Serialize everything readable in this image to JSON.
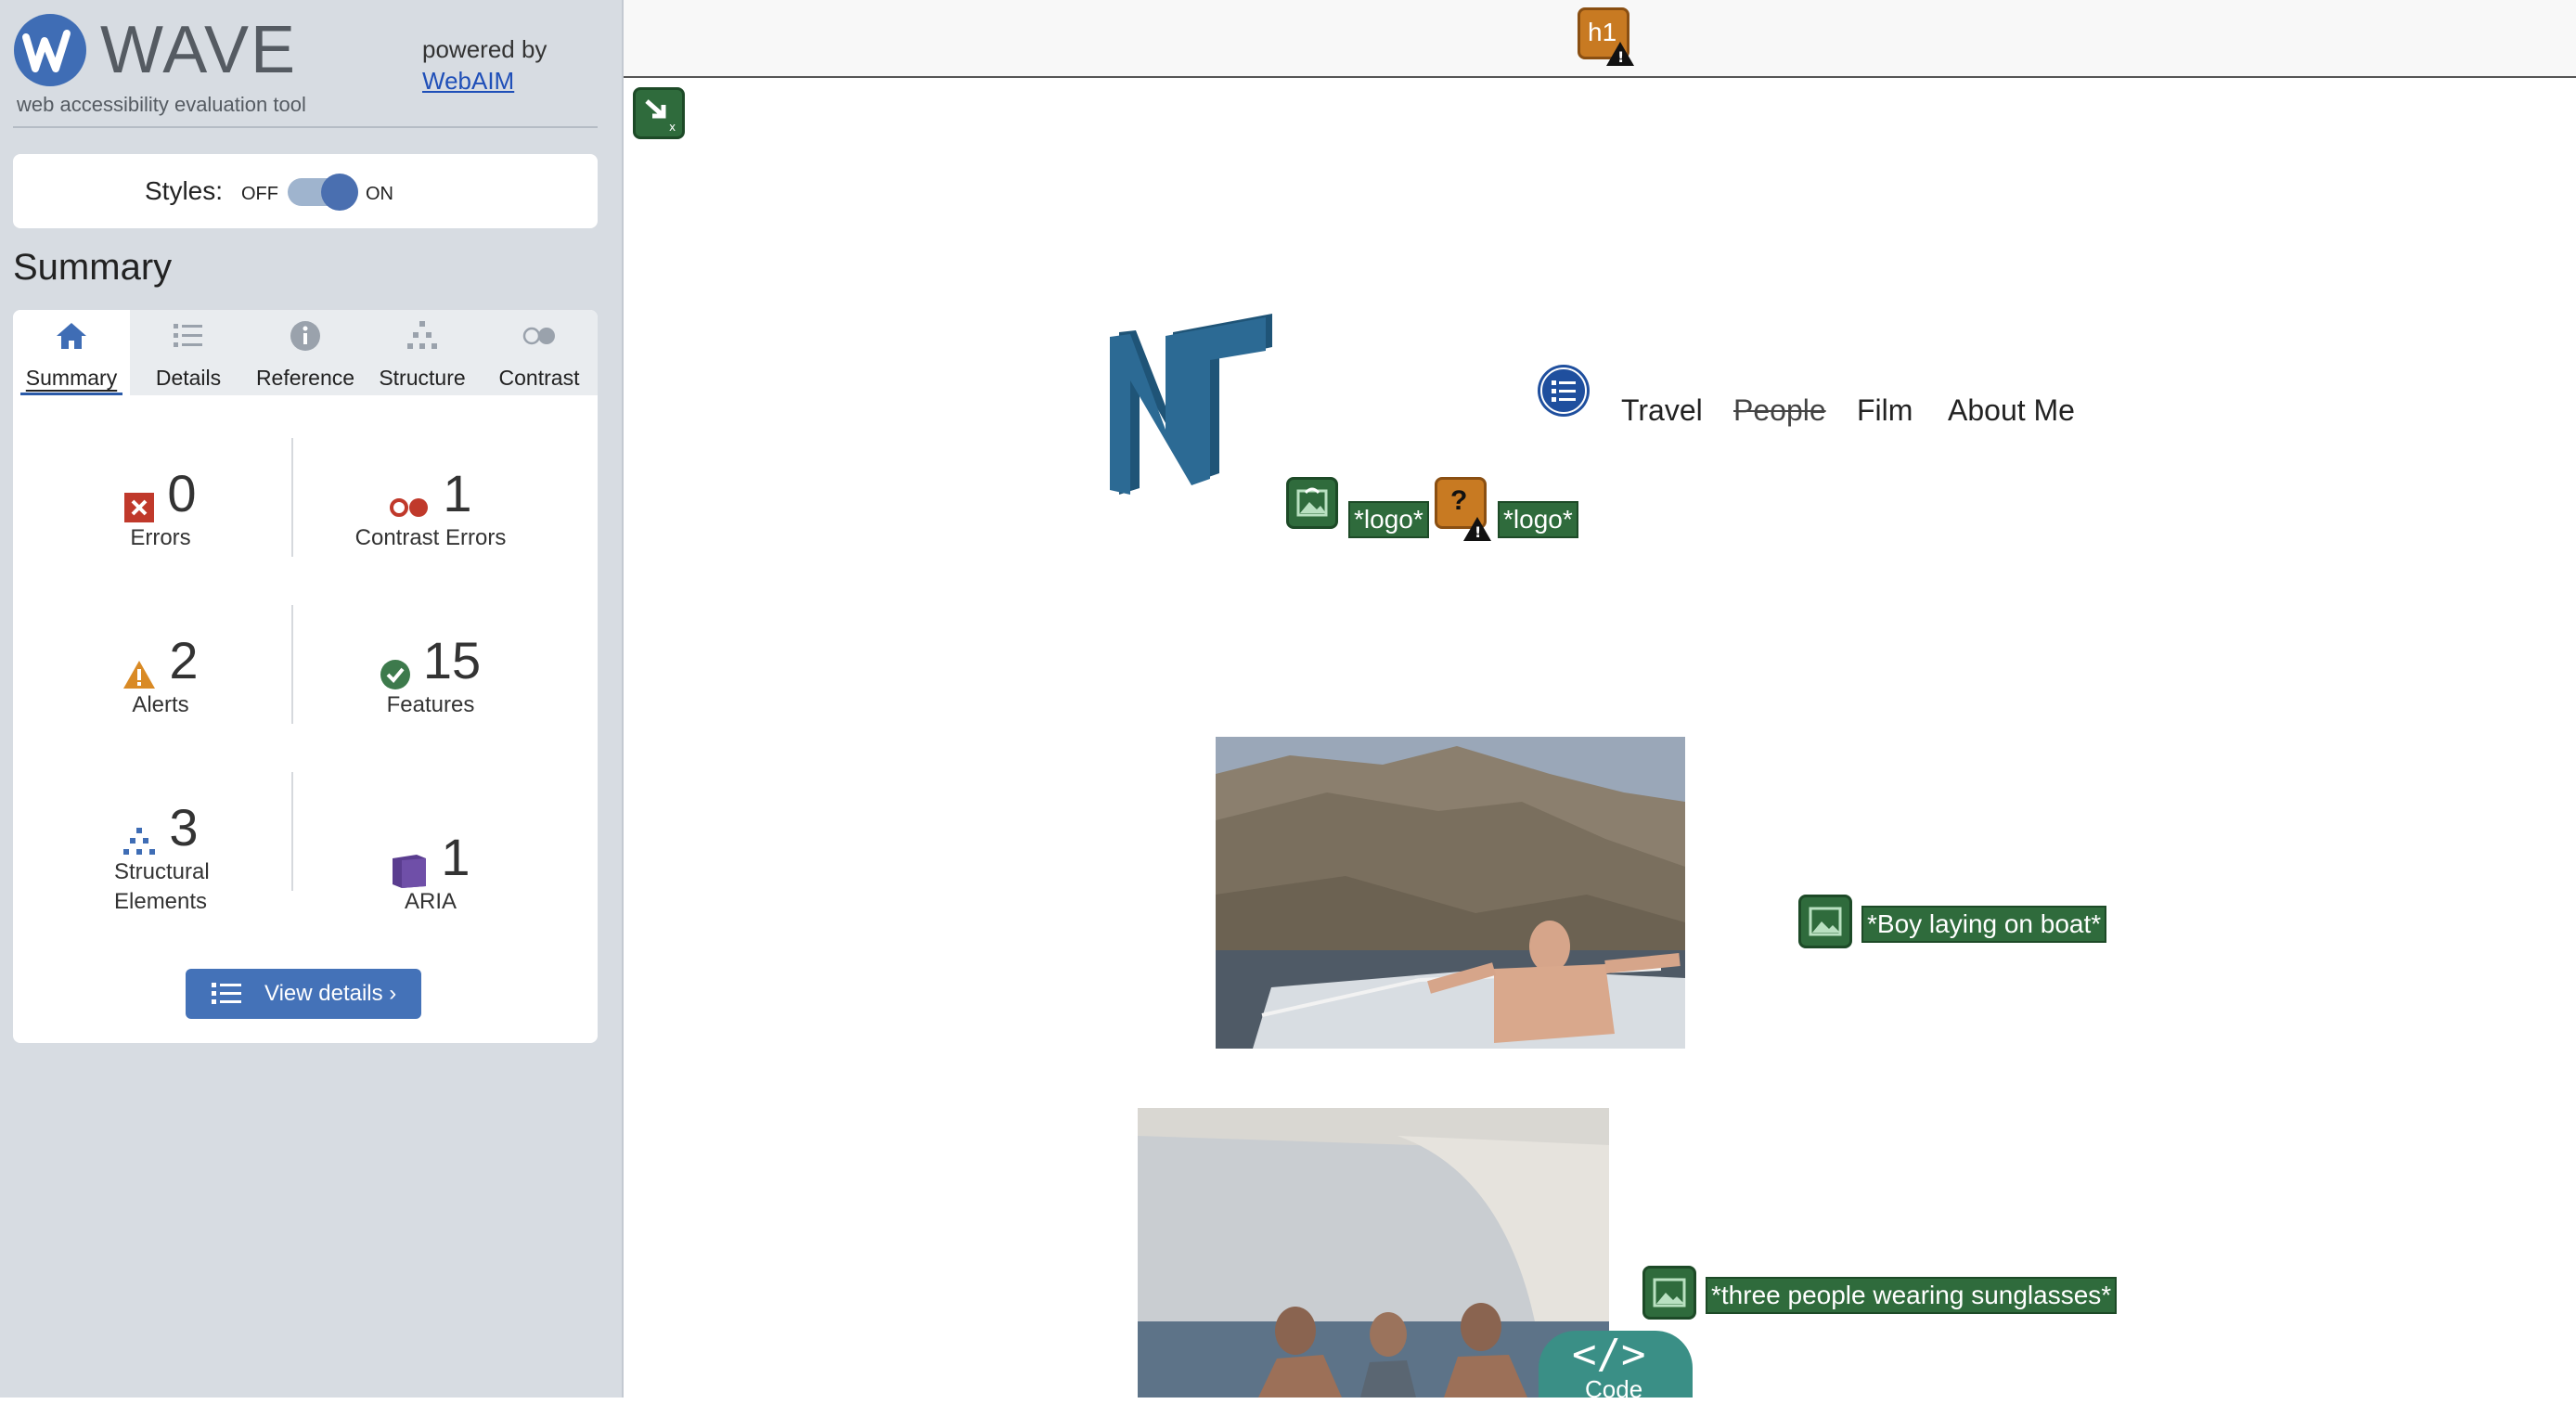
{
  "sidebar": {
    "brand": {
      "title": "WAVE",
      "subtitle": "web accessibility evaluation tool",
      "powered_by": "powered by",
      "powered_link": "WebAIM"
    },
    "styles": {
      "label": "Styles:",
      "off": "OFF",
      "on": "ON",
      "enabled": true
    },
    "summary_heading": "Summary",
    "tabs": [
      {
        "label": "Summary",
        "icon": "home-icon",
        "active": true
      },
      {
        "label": "Details",
        "icon": "list-icon",
        "active": false
      },
      {
        "label": "Reference",
        "icon": "info-icon",
        "active": false
      },
      {
        "label": "Structure",
        "icon": "hierarchy-icon",
        "active": false
      },
      {
        "label": "Contrast",
        "icon": "contrast-icon",
        "active": false
      }
    ],
    "stats": {
      "errors": {
        "count": "0",
        "label": "Errors"
      },
      "contrast_errors": {
        "count": "1",
        "label": "Contrast Errors"
      },
      "alerts": {
        "count": "2",
        "label": "Alerts"
      },
      "features": {
        "count": "15",
        "label": "Features"
      },
      "structural": {
        "count": "3",
        "label": "Structural Elements"
      },
      "aria": {
        "count": "1",
        "label": "ARIA"
      }
    },
    "view_details": "View details ›"
  },
  "page": {
    "h1_badge": "h1",
    "nav": [
      "Travel",
      "People",
      "Film",
      "About Me"
    ],
    "alt_tags": {
      "logo1": "*logo*",
      "logo2": "*logo*",
      "boy": "*Boy laying on boat*",
      "three": "*three people wearing sunglasses*"
    },
    "code_button": "Code"
  },
  "colors": {
    "sidebar_bg": "#d7dce2",
    "accent_blue": "#4472b8",
    "feature_green": "#2f6b3c",
    "alert_orange": "#c87a22",
    "error_red": "#c0392b"
  }
}
